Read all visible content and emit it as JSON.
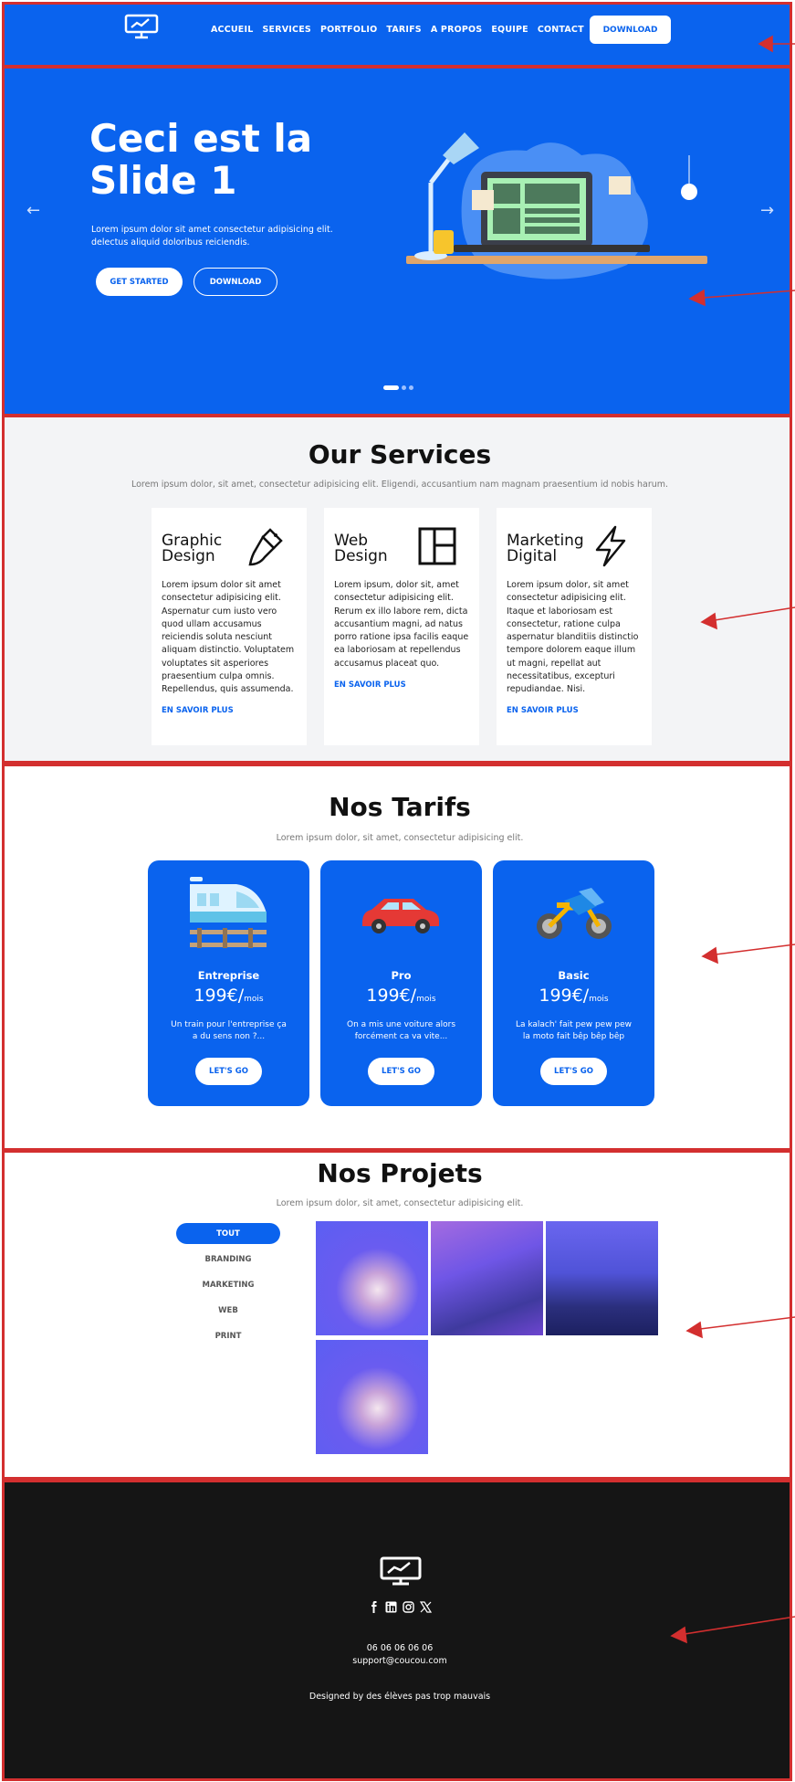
{
  "colors": {
    "brand": "#0a63ee",
    "annotation": "#d32f2f",
    "footer_bg": "#151515",
    "services_bg": "#f3f4f6"
  },
  "header": {
    "logo_icon": "monitor-chart-icon",
    "nav": [
      "ACCUEIL",
      "SERVICES",
      "PORTFOLIO",
      "TARIFS",
      "A PROPOS",
      "EQUIPE",
      "CONTACT"
    ],
    "download_label": "DOWNLOAD"
  },
  "hero": {
    "title": "Ceci est la Slide 1",
    "text": "Lorem ipsum dolor sit amet consectetur adipisicing elit. delectus aliquid doloribus reiciendis.",
    "btn_start": "GET STARTED",
    "btn_download": "DOWNLOAD",
    "prev_icon": "arrow-left-icon",
    "next_icon": "arrow-right-icon",
    "slides_count": 3,
    "active_slide": 1
  },
  "services": {
    "title": "Our Services",
    "subtitle": "Lorem ipsum dolor, sit amet, consectetur adipisicing elit. Eligendi, accusantium nam magnam praesentium id nobis harum.",
    "cards": [
      {
        "title": "Graphic Design",
        "icon": "paint-brush-icon",
        "text": "Lorem ipsum dolor sit amet consectetur adipisicing elit. Aspernatur cum iusto vero quod ullam accusamus reiciendis soluta nesciunt aliquam distinctio. Voluptatem voluptates sit asperiores praesentium culpa omnis. Repellendus, quis assumenda.",
        "link": "EN SAVOIR PLUS"
      },
      {
        "title": "Web Design",
        "icon": "layout-icon",
        "text": "Lorem ipsum, dolor sit, amet consectetur adipisicing elit. Rerum ex illo labore rem, dicta accusantium magni, ad natus porro ratione ipsa facilis eaque ea laboriosam at repellendus accusamus placeat quo.",
        "link": "EN SAVOIR PLUS"
      },
      {
        "title": "Marketing Digital",
        "icon": "lightning-icon",
        "text": "Lorem ipsum dolor, sit amet consectetur adipisicing elit. Itaque et laboriosam est consectetur, ratione culpa aspernatur blanditiis distinctio tempore dolorem eaque illum ut magni, repellat aut necessitatibus, excepturi repudiandae. Nisi.",
        "link": "EN SAVOIR PLUS"
      }
    ]
  },
  "tarifs": {
    "title": "Nos Tarifs",
    "subtitle": "Lorem ipsum dolor, sit amet, consectetur adipisicing elit.",
    "cards": [
      {
        "name": "Entreprise",
        "illustration": "train-icon",
        "price": "199€/",
        "period": "mois",
        "desc": "Un train pour l'entreprise ça a du sens non ?...",
        "button": "LET'S GO"
      },
      {
        "name": "Pro",
        "illustration": "car-icon",
        "price": "199€/",
        "period": "mois",
        "desc": "On a mis une voiture alors forcément ca va vite...",
        "button": "LET'S GO"
      },
      {
        "name": "Basic",
        "illustration": "motorbike-icon",
        "price": "199€/",
        "period": "mois",
        "desc": "La kalach' fait pew pew pew la moto fait bêp bêp bêp",
        "button": "LET'S GO"
      }
    ]
  },
  "projets": {
    "title": "Nos Projets",
    "subtitle": "Lorem ipsum dolor, sit amet, consectetur adipisicing elit.",
    "filters": [
      "TOUT",
      "BRANDING",
      "MARKETING",
      "WEB",
      "PRINT"
    ],
    "active_filter": "TOUT",
    "images": [
      "project-image-1",
      "project-image-2",
      "project-image-3",
      "project-image-4"
    ]
  },
  "footer": {
    "logo_icon": "monitor-chart-icon",
    "socials": [
      "facebook-icon",
      "linkedin-icon",
      "instagram-icon",
      "x-icon"
    ],
    "phone": "06 06 06 06 06",
    "email": "support@coucou.com",
    "credit": "Designed by des élèves pas trop mauvais"
  }
}
